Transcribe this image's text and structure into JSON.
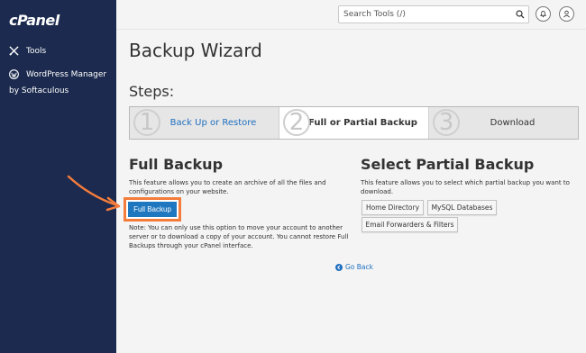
{
  "sidebar": {
    "logo": "cPanel",
    "items": [
      {
        "label": "Tools",
        "icon": "tools-icon"
      },
      {
        "label": "WordPress Manager",
        "icon": "wordpress-icon"
      }
    ],
    "byline": "by Softaculous"
  },
  "header": {
    "search_placeholder": "Search Tools (/)",
    "search_icon": "search-icon",
    "notification_icon": "bell-icon",
    "user_icon": "user-icon"
  },
  "main": {
    "title": "Backup Wizard",
    "steps_label": "Steps:",
    "steps": [
      {
        "number": "1",
        "label": "Back Up or Restore"
      },
      {
        "number": "2",
        "label": "Full or Partial Backup"
      },
      {
        "number": "3",
        "label": "Download"
      }
    ],
    "full": {
      "heading": "Full Backup",
      "description": "This feature allows you to create an archive of all the files and configurations on your website.",
      "button": "Full Backup",
      "note": "Note: You can only use this option to move your account to another server or to download a copy of your account. You cannot restore Full Backups through your cPanel interface."
    },
    "partial": {
      "heading": "Select Partial Backup",
      "description": "This feature allows you to select which partial backup you want to download.",
      "buttons": [
        "Home Directory",
        "MySQL Databases",
        "Email Forwarders & Filters"
      ]
    },
    "go_back": "Go Back"
  },
  "colors": {
    "sidebar": "#1b2a4e",
    "primary_button": "#1f77bf",
    "highlight": "#f47c3c",
    "link": "#1f6fbf"
  }
}
